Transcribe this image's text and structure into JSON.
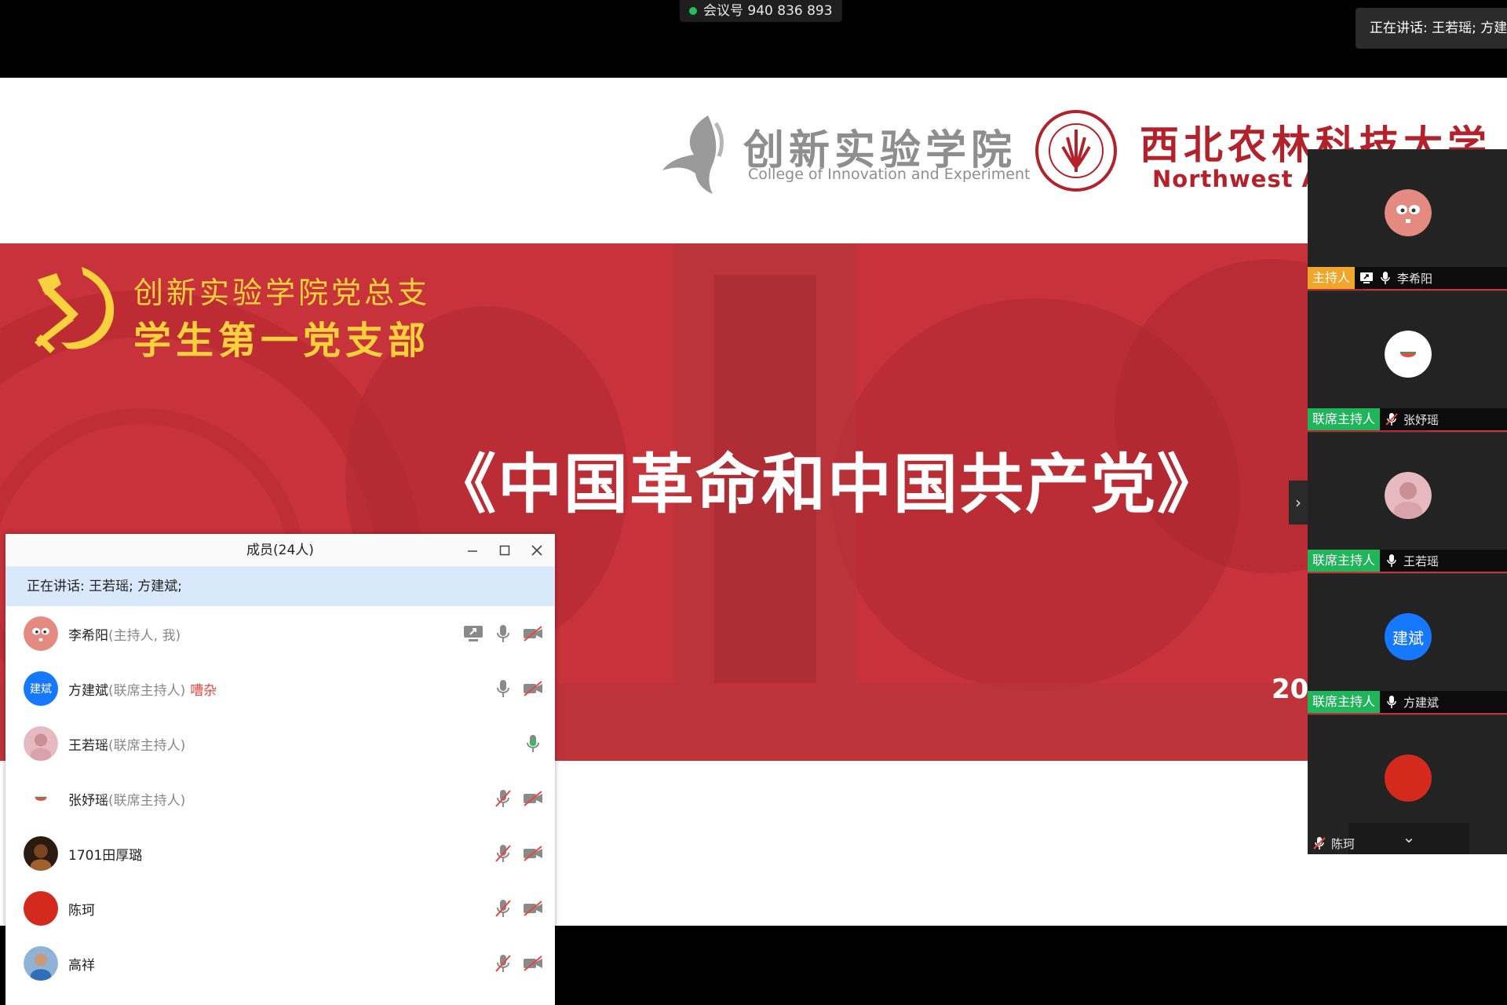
{
  "meeting": {
    "id_label": "会议号 940 836 893",
    "speaking_toast": "正在讲话: 王若瑶; 方建斌"
  },
  "slide": {
    "college_cn": "创新实验学院",
    "college_en": "College of Innovation and Experiment",
    "university_cn": "西北农林科技大学",
    "university_en": "Northwest A&",
    "branch_line1": "创新实验学院党总支",
    "branch_line2": "学生第一党支部",
    "title": "《中国革命和中国共产党》",
    "date_fragment": "20",
    "colors": {
      "banner": "#c8323a",
      "gold": "#f7d23c",
      "univ_red": "#b3222a"
    }
  },
  "video_tiles": [
    {
      "role": "主持人",
      "role_kind": "host",
      "mic": "on",
      "sharing": true,
      "name": "李希阳",
      "avatar": "pink-face"
    },
    {
      "role": "联席主持人",
      "role_kind": "cohost",
      "mic": "muted",
      "sharing": false,
      "name": "张妤瑶",
      "avatar": "watermelon"
    },
    {
      "role": "联席主持人",
      "role_kind": "cohost",
      "mic": "on",
      "sharing": false,
      "name": "王若瑶",
      "avatar": "photo-girl"
    },
    {
      "role": "联席主持人",
      "role_kind": "cohost",
      "mic": "on",
      "sharing": false,
      "name": "方建斌",
      "avatar": "text",
      "avatar_text": "建斌"
    },
    {
      "role": "",
      "role_kind": "none",
      "mic": "muted",
      "sharing": false,
      "name": "陈珂",
      "avatar": "red-circle"
    }
  ],
  "members_panel": {
    "title": "成员(24人)",
    "speaking": "正在讲话: 王若瑶; 方建斌;",
    "members": [
      {
        "name": "李希阳",
        "role": "(主持人, 我)",
        "noise": "",
        "avatar": "pink-face",
        "share": true,
        "mic": "on",
        "camera": "off"
      },
      {
        "name": "方建斌",
        "role": "(联席主持人)",
        "noise": "嘈杂",
        "avatar": "text",
        "avatar_text": "建斌",
        "share": false,
        "mic": "on",
        "camera": "off"
      },
      {
        "name": "王若瑶",
        "role": "(联席主持人)",
        "noise": "",
        "avatar": "photo-girl",
        "share": false,
        "mic": "active",
        "camera": "none"
      },
      {
        "name": "张妤瑶",
        "role": "(联席主持人)",
        "noise": "",
        "avatar": "watermelon",
        "share": false,
        "mic": "muted",
        "camera": "off"
      },
      {
        "name": "1701田厚璐",
        "role": "",
        "noise": "",
        "avatar": "photo-dark",
        "share": false,
        "mic": "muted",
        "camera": "off"
      },
      {
        "name": "陈珂",
        "role": "",
        "noise": "",
        "avatar": "red-circle",
        "share": false,
        "mic": "muted",
        "camera": "off"
      },
      {
        "name": "高祥",
        "role": "",
        "noise": "",
        "avatar": "photo-sport",
        "share": false,
        "mic": "muted",
        "camera": "off"
      }
    ]
  }
}
